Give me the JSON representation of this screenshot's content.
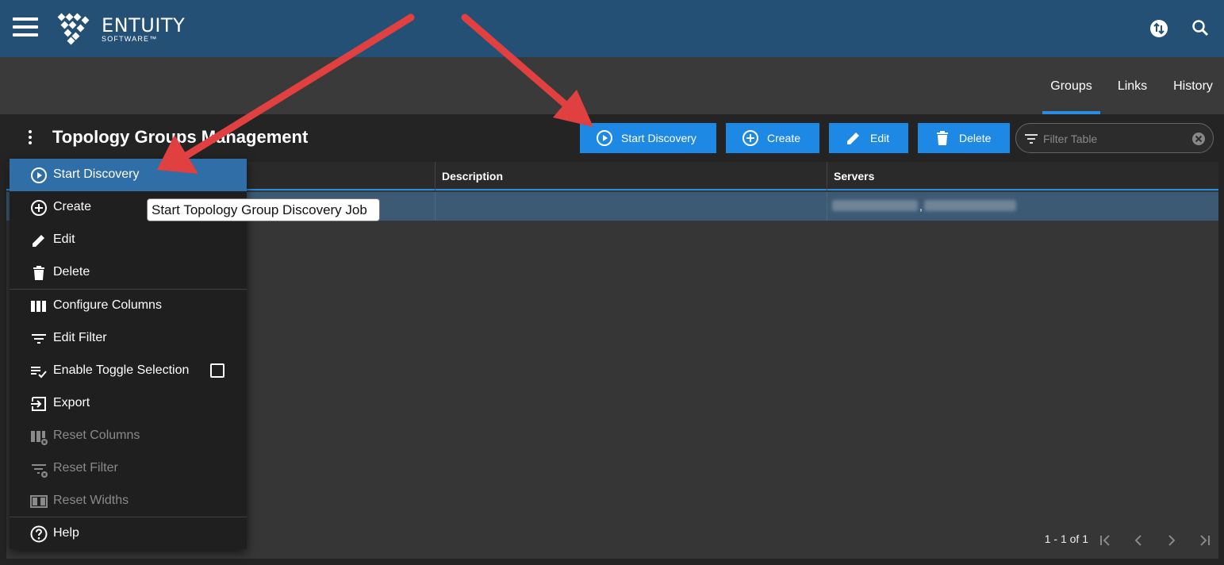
{
  "brand": {
    "name": "ENTUITY",
    "subtitle": "SOFTWARE™"
  },
  "header": {
    "icons": [
      "menu-icon",
      "sync-icon",
      "search-icon"
    ]
  },
  "tabs": [
    {
      "label": "Groups",
      "active": true
    },
    {
      "label": "Links",
      "active": false
    },
    {
      "label": "History",
      "active": false
    }
  ],
  "page": {
    "title": "Topology Groups Management"
  },
  "toolbar": {
    "start_discovery": "Start Discovery",
    "create": "Create",
    "edit": "Edit",
    "delete": "Delete",
    "filter_placeholder": "Filter Table"
  },
  "table": {
    "columns": [
      "Description",
      "Servers"
    ],
    "rows": [
      {
        "servers_separator": ","
      }
    ]
  },
  "pagination": {
    "text": "1 - 1 of 1"
  },
  "menu": {
    "items": [
      {
        "label": "Start Discovery",
        "icon": "play-circle-icon",
        "enabled": true,
        "highlighted": true
      },
      {
        "label": "Create",
        "icon": "add-circle-icon",
        "enabled": true
      },
      {
        "label": "Edit",
        "icon": "pencil-icon",
        "enabled": true
      },
      {
        "label": "Delete",
        "icon": "trash-icon",
        "enabled": true
      },
      {
        "label": "Configure Columns",
        "icon": "columns-icon",
        "enabled": true
      },
      {
        "label": "Edit Filter",
        "icon": "filter-icon",
        "enabled": true
      },
      {
        "label": "Enable Toggle Selection",
        "icon": "checklist-icon",
        "enabled": true,
        "checked": false
      },
      {
        "label": "Export",
        "icon": "export-icon",
        "enabled": true
      },
      {
        "label": "Reset Columns",
        "icon": "reset-columns-icon",
        "enabled": false
      },
      {
        "label": "Reset Filter",
        "icon": "reset-filter-icon",
        "enabled": false
      },
      {
        "label": "Reset Widths",
        "icon": "reset-widths-icon",
        "enabled": false
      },
      {
        "label": "Help",
        "icon": "help-icon",
        "enabled": true
      }
    ]
  },
  "tooltip": {
    "text": "Start Topology Group Discovery Job"
  },
  "colors": {
    "header": "#245075",
    "accent": "#1e88e5",
    "annotation_arrow": "#e04040"
  }
}
